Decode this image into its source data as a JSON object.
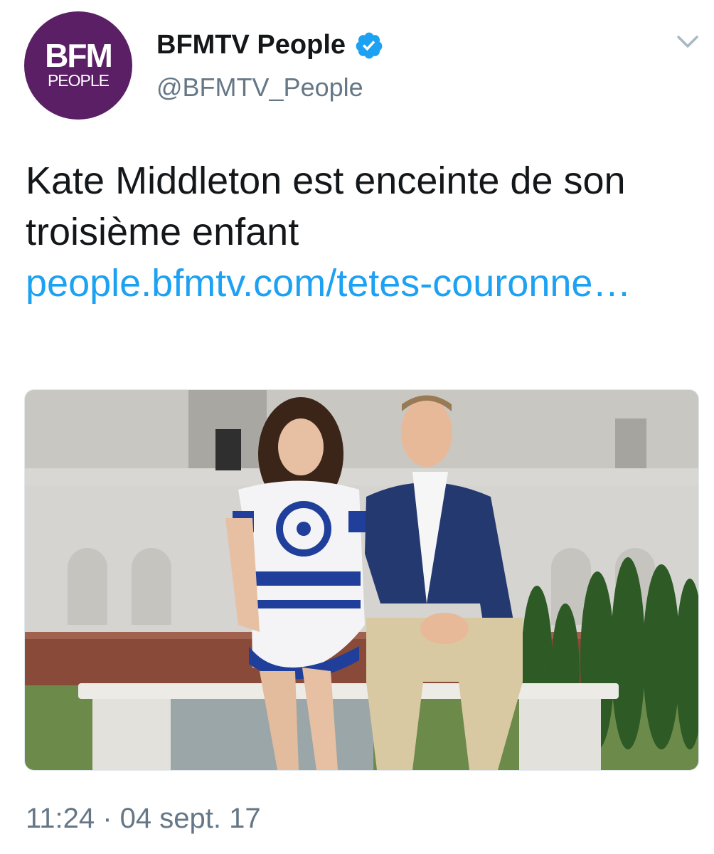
{
  "author": {
    "avatar": {
      "logo_main": "BFM",
      "logo_sub": "PEOPLE",
      "bg_color": "#5b1f66"
    },
    "display_name": "BFMTV People",
    "handle": "@BFMTV_People",
    "verified_icon": "verified-badge-icon"
  },
  "menu_icon": "chevron-down-icon",
  "tweet": {
    "text": "Kate Middleton est enceinte de son troisième enfant",
    "link": "people.bfmtv.com/tetes-couronne…",
    "link_color": "#1da1f2"
  },
  "media": {
    "kind": "photo"
  },
  "timestamp": "11:24 · 04 sept. 17",
  "colors": {
    "text": "#14171a",
    "secondary": "#657786",
    "accent": "#1da1f2"
  }
}
